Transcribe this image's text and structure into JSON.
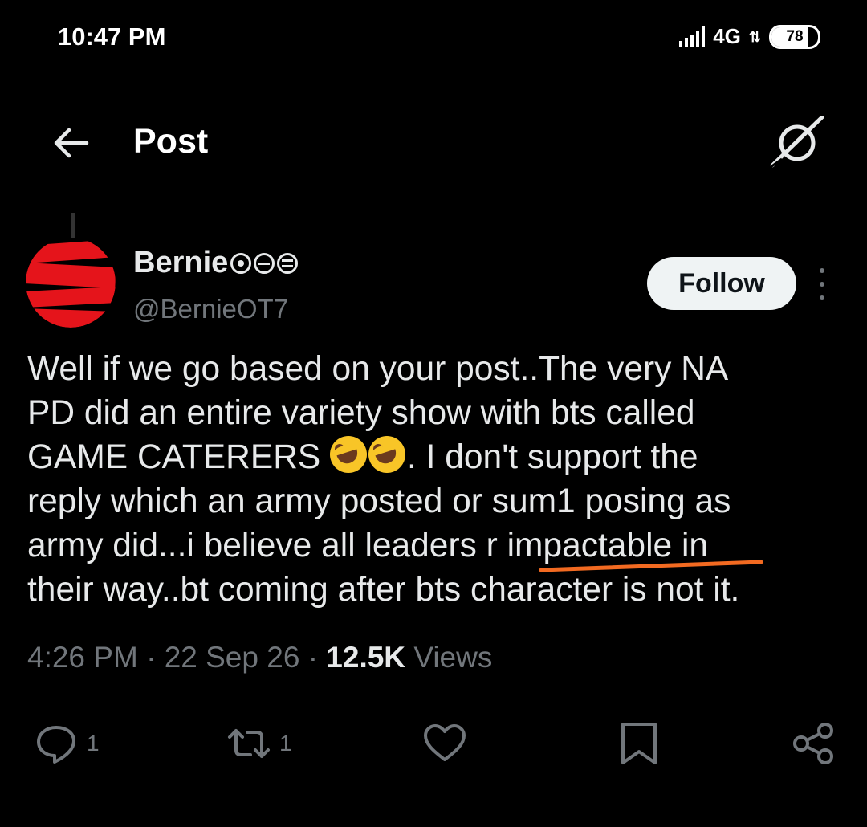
{
  "status_bar": {
    "time": "10:47 PM",
    "network": "4G",
    "battery": "78",
    "battery_level": 0.78
  },
  "header": {
    "title": "Post",
    "back_icon": "arrow-left-icon",
    "grok_icon": "grok-icon"
  },
  "author": {
    "name": "Bernie",
    "handle": "@BernieOT7",
    "follow_label": "Follow"
  },
  "post": {
    "line1": "Well if we go based on your post..The very NA",
    "line2": "PD did an entire variety show with bts called",
    "line3_a": "GAME CATERERS ",
    "line3_b": ". I don't support the",
    "line4": "reply which an army posted or sum1 posing as",
    "line5": "army did...i believe all leaders r impactable in",
    "line6": "their way..bt coming after bts character is not it.",
    "emoji_icon": "rolling-on-floor-laughing-emoji",
    "annotation_color": "#f26a21"
  },
  "meta": {
    "time": "4:26 PM",
    "date": "22 Sep 26",
    "views_count": "12.5K",
    "views_label": "Views",
    "separator": "·"
  },
  "actions": {
    "reply_count": "1",
    "repost_count": "1"
  },
  "colors": {
    "background": "#000000",
    "text": "#e7e9ea",
    "secondary": "#71767b",
    "avatar_red": "#e5141b"
  }
}
